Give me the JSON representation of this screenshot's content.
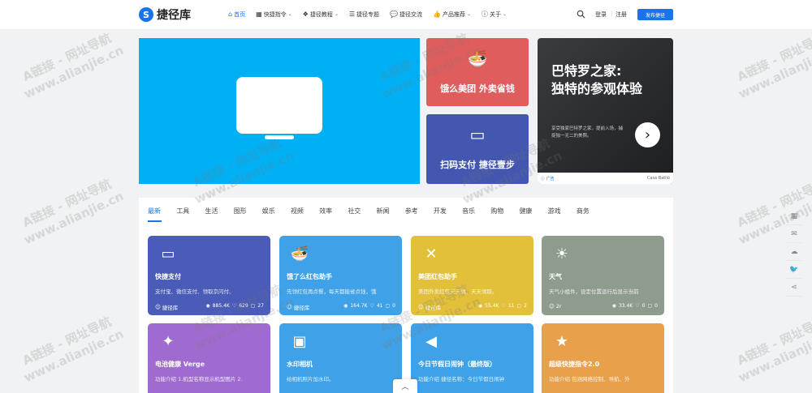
{
  "header": {
    "logo_mark": "S",
    "logo_text": "捷径库",
    "nav": [
      {
        "label": "首页",
        "icon": "⌂",
        "caret": false,
        "active": true
      },
      {
        "label": "快捷指令",
        "icon": "▦",
        "caret": true,
        "active": false
      },
      {
        "label": "捷径教程",
        "icon": "❖",
        "caret": true,
        "active": false
      },
      {
        "label": "捷径专题",
        "icon": "☰",
        "caret": false,
        "active": false
      },
      {
        "label": "捷径交流",
        "icon": "💬",
        "caret": false,
        "active": false
      },
      {
        "label": "产品推荐",
        "icon": "👍",
        "caret": true,
        "active": false
      },
      {
        "label": "关于",
        "icon": "ⓘ",
        "caret": true,
        "active": false
      }
    ],
    "login": "登录",
    "sep": "|",
    "register": "注册",
    "post_button": "发布捷径"
  },
  "promos": [
    {
      "text": "饿么美团 外卖省钱",
      "icon": "🍜",
      "color": "#e05d5d"
    },
    {
      "text": "扫码支付 捷径壹步",
      "icon": "▭",
      "color": "#4357b0"
    }
  ],
  "ad": {
    "title_line1": "巴特罗之家:",
    "title_line2": "独特的参观体验",
    "desc": "享受独家巴特罗之家，提前入场，捕捉独一无二的美照。",
    "arrow": "›",
    "ad_label": "ⓘ 广告",
    "brand": "Casa Batlló"
  },
  "tabs": [
    "最新",
    "工具",
    "生活",
    "图形",
    "娱乐",
    "视频",
    "效率",
    "社交",
    "新闻",
    "参考",
    "开发",
    "音乐",
    "购物",
    "健康",
    "游戏",
    "商务"
  ],
  "cards": [
    {
      "title": "快捷支付",
      "desc": "支付宝、微信支付、领取京闪付、",
      "author": "捷径库",
      "views": "885.4K",
      "likes": "629",
      "comments": "27",
      "color": "#4a5cb8",
      "icon": "▭"
    },
    {
      "title": "饿了么红包助手",
      "desc": "先领红包再点餐，每天都能省点钱，饿",
      "author": "捷径库",
      "views": "164.7K",
      "likes": "41",
      "comments": "0",
      "color": "#3fa2e8",
      "icon": "🍜"
    },
    {
      "title": "美团红包助手",
      "desc": "美团外卖红包天天领，天天领取。",
      "author": "捷径库",
      "views": "55.4K",
      "likes": "11",
      "comments": "2",
      "color": "#e2c03a",
      "icon": "✕"
    },
    {
      "title": "天气",
      "desc": "天气小组件，设定位置运行后显示当前",
      "author": "2r",
      "views": "33.4K",
      "likes": "0",
      "comments": "0",
      "color": "#8e9c8e",
      "icon": "☀"
    },
    {
      "title": "电池健康 Verge",
      "desc": "功能介绍 1.机型名称显示机型图片 2.",
      "author": "",
      "views": "",
      "likes": "",
      "comments": "",
      "color": "#a06bd0",
      "icon": "✦"
    },
    {
      "title": "水印相机",
      "desc": "给相机照片加水印。",
      "author": "",
      "views": "",
      "likes": "",
      "comments": "",
      "color": "#3fa2e8",
      "icon": "▣"
    },
    {
      "title": "今日节假日闹钟（最终版）",
      "desc": "功能介绍 捷径名称：今日节假日闹钟",
      "author": "",
      "views": "",
      "likes": "",
      "comments": "",
      "color": "#3fa2e8",
      "icon": "◀"
    },
    {
      "title": "超级快捷指令2.0",
      "desc": "功能介绍 包涵网络控制、导航、外",
      "author": "",
      "views": "",
      "likes": "",
      "comments": "",
      "color": "#e8a04a",
      "icon": "★"
    }
  ],
  "scroll_top": "︿",
  "sidebar": [
    "▦",
    "✉",
    "☁",
    "🐦",
    "⋖"
  ],
  "watermark": {
    "line1": "A链接 - 网址导航",
    "line2": "www.alianjie.cn"
  }
}
